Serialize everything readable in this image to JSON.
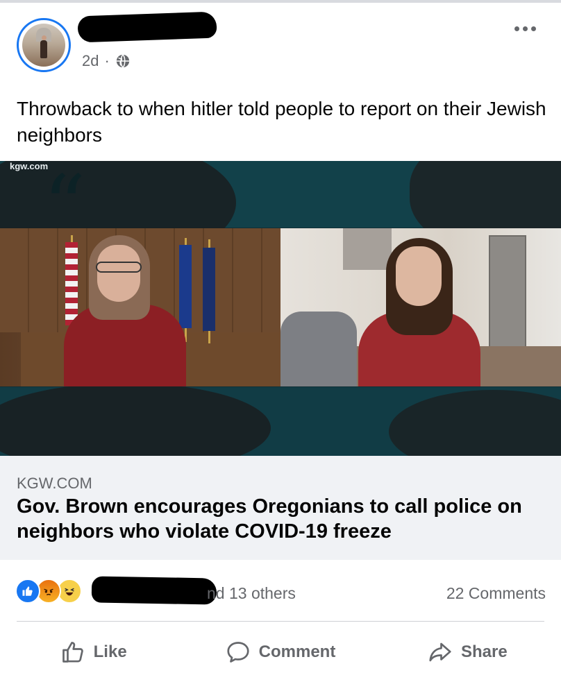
{
  "post": {
    "author_name": "",
    "timestamp": "2d",
    "separator": "·",
    "visibility_icon": "globe-icon",
    "text": "Throwback to when hitler told people to report on their Jewish neighbors"
  },
  "media": {
    "watermark": "kgw.com",
    "description_icon": "quote-icon"
  },
  "link_preview": {
    "domain": "KGW.COM",
    "title": "Gov. Brown encourages Oregonians to call police on neighbors who violate COVID-19 freeze"
  },
  "engagement": {
    "reaction_icons": [
      "like-icon",
      "angry-icon",
      "haha-icon"
    ],
    "others_text": "nd 13 others",
    "comments_text": "22 Comments"
  },
  "actions": {
    "like": "Like",
    "comment": "Comment",
    "share": "Share"
  },
  "colors": {
    "accent": "#1877f2",
    "secondary_text": "#65676b",
    "link_bg": "#f0f2f5"
  }
}
